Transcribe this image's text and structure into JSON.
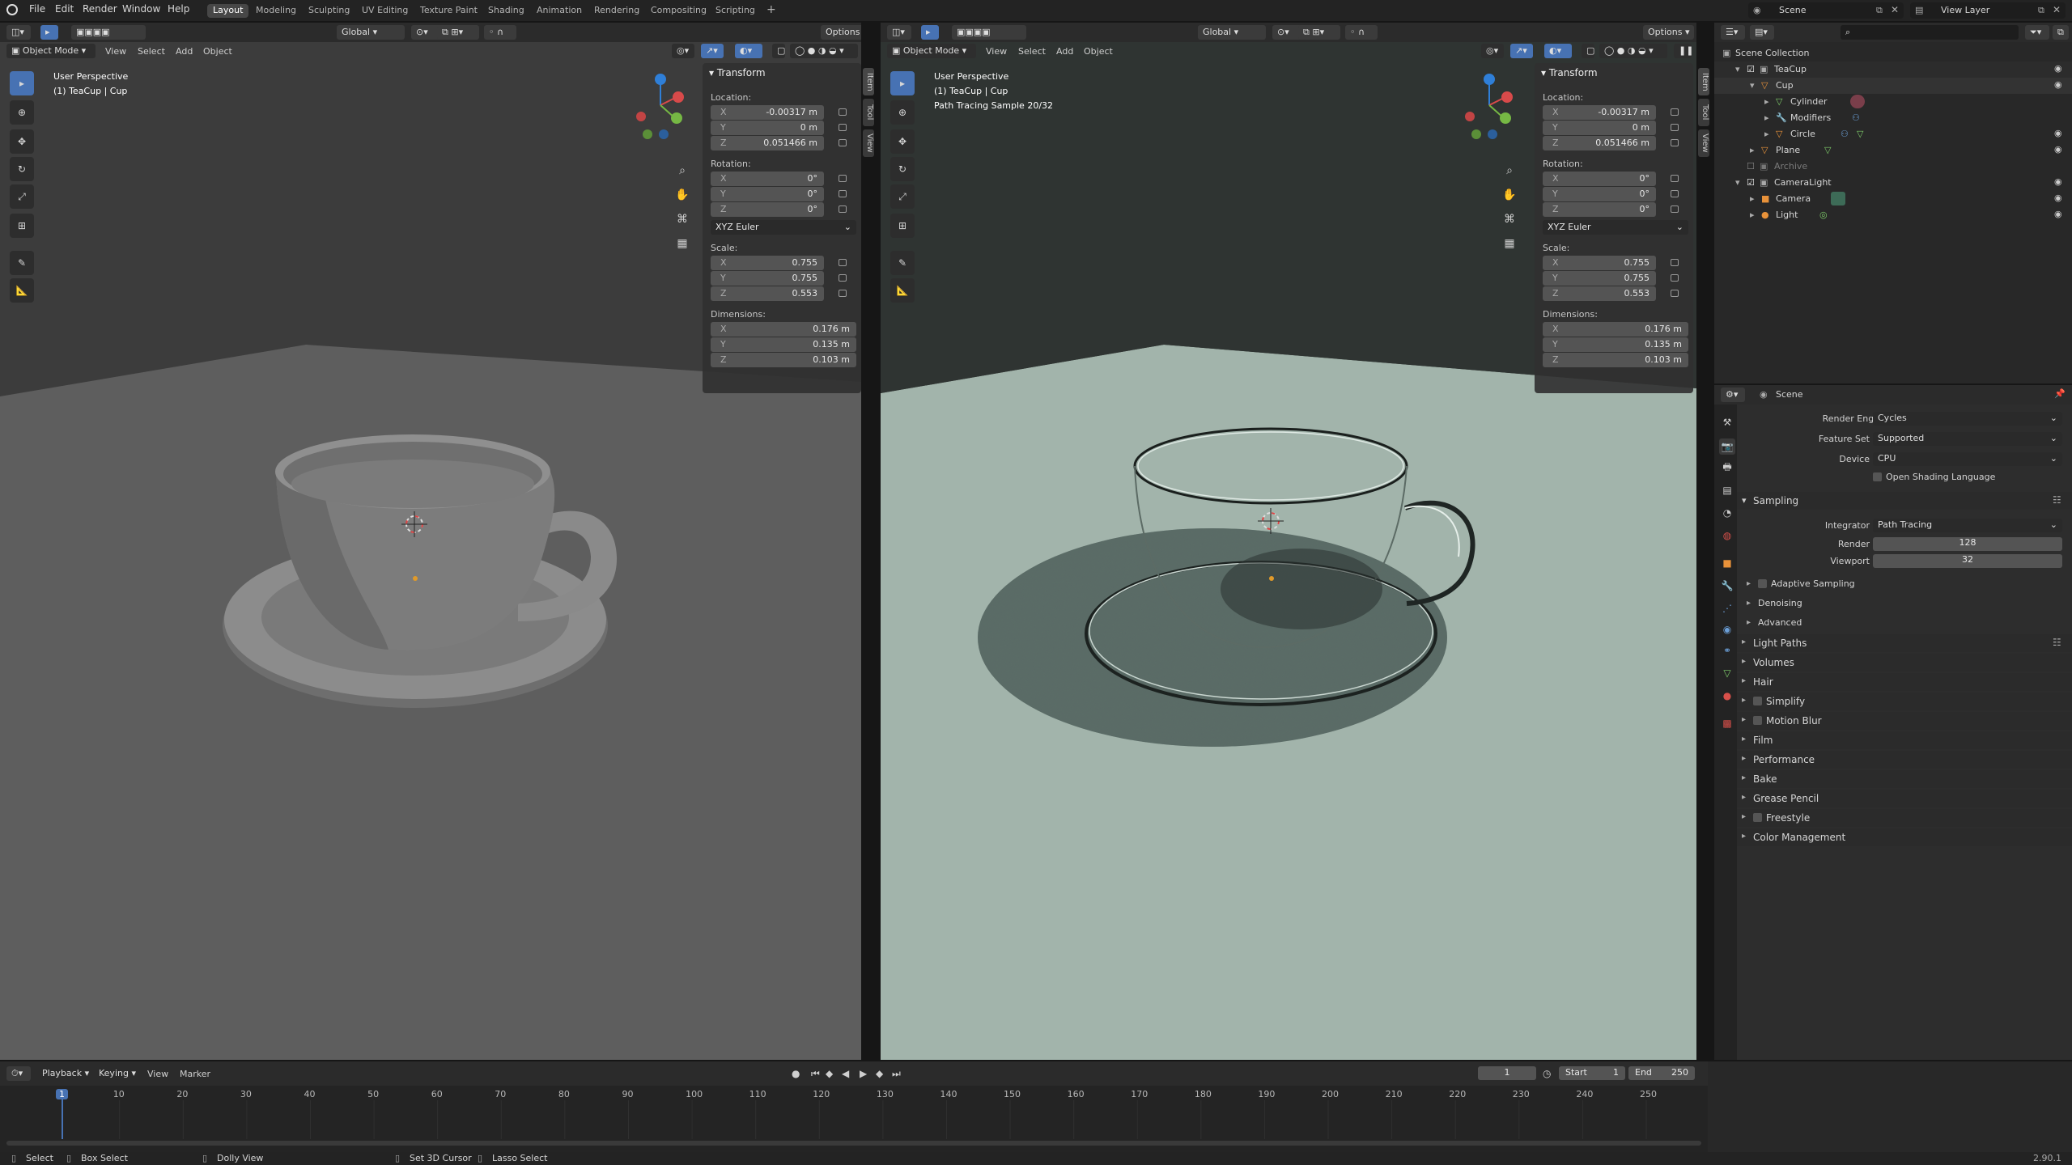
{
  "topbar": {
    "menus": [
      "File",
      "Edit",
      "Render",
      "Window",
      "Help"
    ],
    "workspaces": [
      "Layout",
      "Modeling",
      "Sculpting",
      "UV Editing",
      "Texture Paint",
      "Shading",
      "Animation",
      "Rendering",
      "Compositing",
      "Scripting"
    ],
    "active_workspace": "Layout",
    "scene_label": "Scene",
    "view_layer_label": "View Layer"
  },
  "viewport_left": {
    "transform_orientation": "Global",
    "options_label": "Options",
    "mode": "Object Mode",
    "menus": [
      "View",
      "Select",
      "Add",
      "Object"
    ],
    "perspective": "User Perspective",
    "object_info": "(1) TeaCup | Cup",
    "sample_info": ""
  },
  "viewport_right": {
    "transform_orientation": "Global",
    "options_label": "Options",
    "mode": "Object Mode",
    "menus": [
      "View",
      "Select",
      "Add",
      "Object"
    ],
    "perspective": "User Perspective",
    "object_info": "(1) TeaCup | Cup",
    "sample_info": "Path Tracing Sample 20/32"
  },
  "npanel": {
    "title": "Transform",
    "location_label": "Location:",
    "location": {
      "x": "-0.00317 m",
      "y": "0 m",
      "z": "0.051466 m"
    },
    "rotation_label": "Rotation:",
    "rotation": {
      "x": "0°",
      "y": "0°",
      "z": "0°"
    },
    "rotation_mode": "XYZ Euler",
    "scale_label": "Scale:",
    "scale": {
      "x": "0.755",
      "y": "0.755",
      "z": "0.553"
    },
    "dimensions_label": "Dimensions:",
    "dimensions": {
      "x": "0.176 m",
      "y": "0.135 m",
      "z": "0.103 m"
    },
    "axis": {
      "x": "X",
      "y": "Y",
      "z": "Z"
    },
    "tabs": [
      "Item",
      "Tool",
      "View"
    ]
  },
  "outliner": {
    "rows": [
      {
        "label": "Scene Collection"
      },
      {
        "label": "TeaCup"
      },
      {
        "label": "Cup"
      },
      {
        "label": "Cylinder"
      },
      {
        "label": "Modifiers"
      },
      {
        "label": "Circle"
      },
      {
        "label": "Plane"
      },
      {
        "label": "Archive"
      },
      {
        "label": "CameraLight"
      },
      {
        "label": "Camera"
      },
      {
        "label": "Light"
      }
    ]
  },
  "properties": {
    "context": "Scene",
    "render_engine_label": "Render Engine",
    "render_engine": "Cycles",
    "feature_set_label": "Feature Set",
    "feature_set": "Supported",
    "device_label": "Device",
    "device": "CPU",
    "osl_label": "Open Shading Language",
    "sampling_label": "Sampling",
    "integrator_label": "Integrator",
    "integrator": "Path Tracing",
    "render_label": "Render",
    "render_samples": "128",
    "viewport_label": "Viewport",
    "viewport_samples": "32",
    "sampling_sub": [
      "Adaptive Sampling",
      "Denoising",
      "Advanced"
    ],
    "sections": [
      "Light Paths",
      "Volumes",
      "Hair",
      "Simplify",
      "Motion Blur",
      "Film",
      "Performance",
      "Bake",
      "Grease Pencil",
      "Freestyle",
      "Color Management"
    ]
  },
  "timeline": {
    "menus": [
      "Playback",
      "Keying",
      "View",
      "Marker"
    ],
    "current_frame": "1",
    "start_label": "Start",
    "start": "1",
    "end_label": "End",
    "end": "250",
    "ticks": [
      "1",
      "10",
      "20",
      "30",
      "40",
      "50",
      "60",
      "70",
      "80",
      "90",
      "100",
      "110",
      "120",
      "130",
      "140",
      "150",
      "160",
      "170",
      "180",
      "190",
      "200",
      "210",
      "220",
      "230",
      "240",
      "250"
    ]
  },
  "statusbar": {
    "items": [
      "Select",
      "Box Select",
      "Dolly View",
      "Set 3D Cursor",
      "Lasso Select"
    ],
    "version": "2.90.1"
  },
  "colors": {
    "accent": "#4772b3",
    "viewport_left_bg": "#5a5a5a",
    "viewport_right_bg": "#9fb0a8"
  }
}
